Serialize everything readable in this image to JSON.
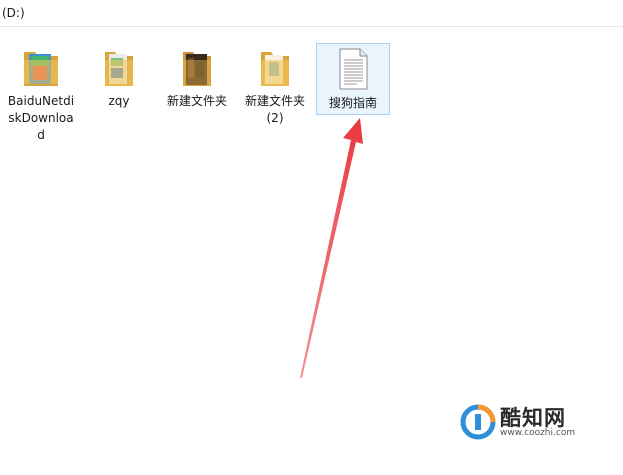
{
  "address_bar": {
    "path": "(D:)"
  },
  "items": [
    {
      "name": "BaiduNetdiskDownload",
      "type": "folder"
    },
    {
      "name": "zqy",
      "type": "folder"
    },
    {
      "name": "新建文件夹",
      "type": "folder"
    },
    {
      "name": "新建文件夹 (2)",
      "type": "folder"
    },
    {
      "name": "搜狗指南",
      "type": "text-file",
      "selected": true
    }
  ],
  "colors": {
    "folder": "#f3c65a",
    "folder_dark": "#d9a53a",
    "selection_bg": "#eaf4fd",
    "selection_border": "#a8d0f2",
    "arrow": "#e8383d"
  },
  "watermark": {
    "brand": "酷知网",
    "url": "www.coozhi.com"
  }
}
